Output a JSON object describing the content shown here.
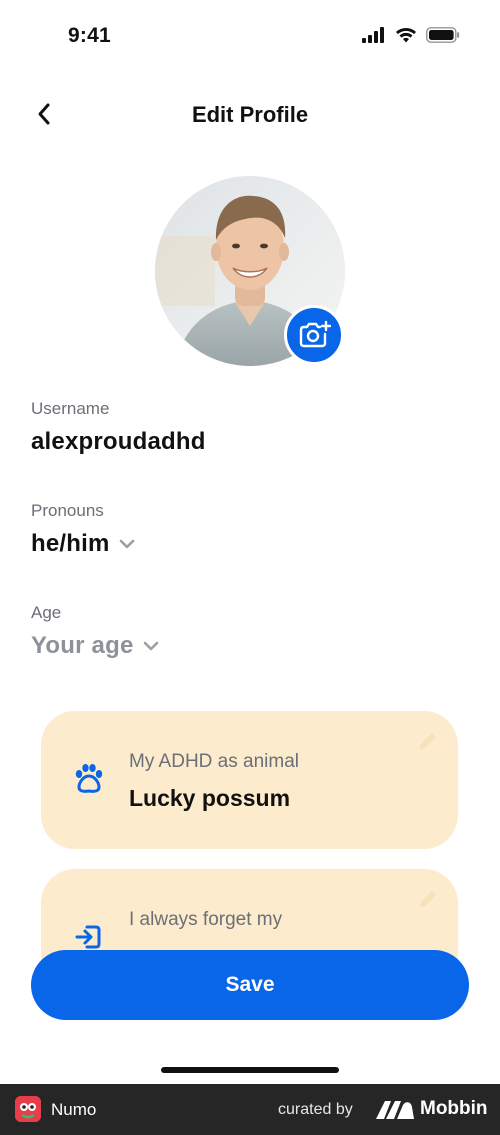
{
  "status_bar": {
    "time": "9:41",
    "icons": [
      "signal-icon",
      "wifi-icon",
      "battery-icon"
    ]
  },
  "header": {
    "title": "Edit Profile",
    "back_icon": "chevron-left-icon"
  },
  "profile": {
    "avatar_icon": "avatar-photo",
    "camera_icon": "camera-plus-icon"
  },
  "fields": {
    "username": {
      "label": "Username",
      "value": "alexproudadhd"
    },
    "pronouns": {
      "label": "Pronouns",
      "value": "he/him"
    },
    "age": {
      "label": "Age",
      "placeholder": "Your age"
    }
  },
  "cards": [
    {
      "label": "My ADHD as animal",
      "value": "Lucky possum",
      "icon": "paw-icon",
      "edit_icon": "pencil-icon"
    },
    {
      "label": "I always forget my",
      "value": "",
      "icon": "login-arrow-icon",
      "edit_icon": "pencil-icon"
    }
  ],
  "actions": {
    "save_label": "Save"
  },
  "footer": {
    "app_name": "Numo",
    "curated_by": "curated by",
    "brand": "Mobbin"
  },
  "colors": {
    "accent": "#0a66e8",
    "card_bg": "#fdebcd",
    "muted_text": "#6b6f76",
    "footer_bg": "#262626"
  }
}
